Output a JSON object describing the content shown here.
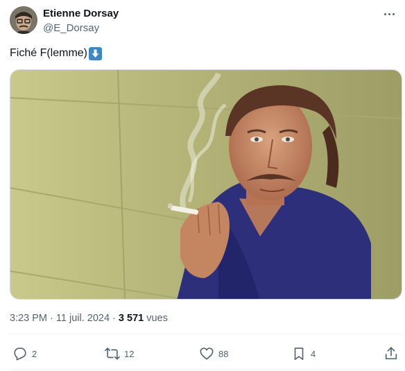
{
  "author": {
    "name": "Etienne Dorsay",
    "handle": "@E_Dorsay"
  },
  "tweet": {
    "text": "Fiché F(lemme)",
    "emoji": "down-arrow-emoji"
  },
  "meta": {
    "time": "3:23 PM",
    "separator": " · ",
    "date": "11 juil. 2024",
    "views_count": "3 571",
    "views_label": " vues"
  },
  "actions": {
    "replies": "2",
    "reposts": "12",
    "likes": "88",
    "bookmarks": "4"
  },
  "colors": {
    "text_primary": "#0f1419",
    "text_secondary": "#536471",
    "border": "#cfd9de",
    "emoji_blue": "#3b88c3"
  },
  "icons": [
    "more-icon",
    "reply-icon",
    "repost-icon",
    "like-icon",
    "bookmark-icon",
    "share-icon"
  ]
}
